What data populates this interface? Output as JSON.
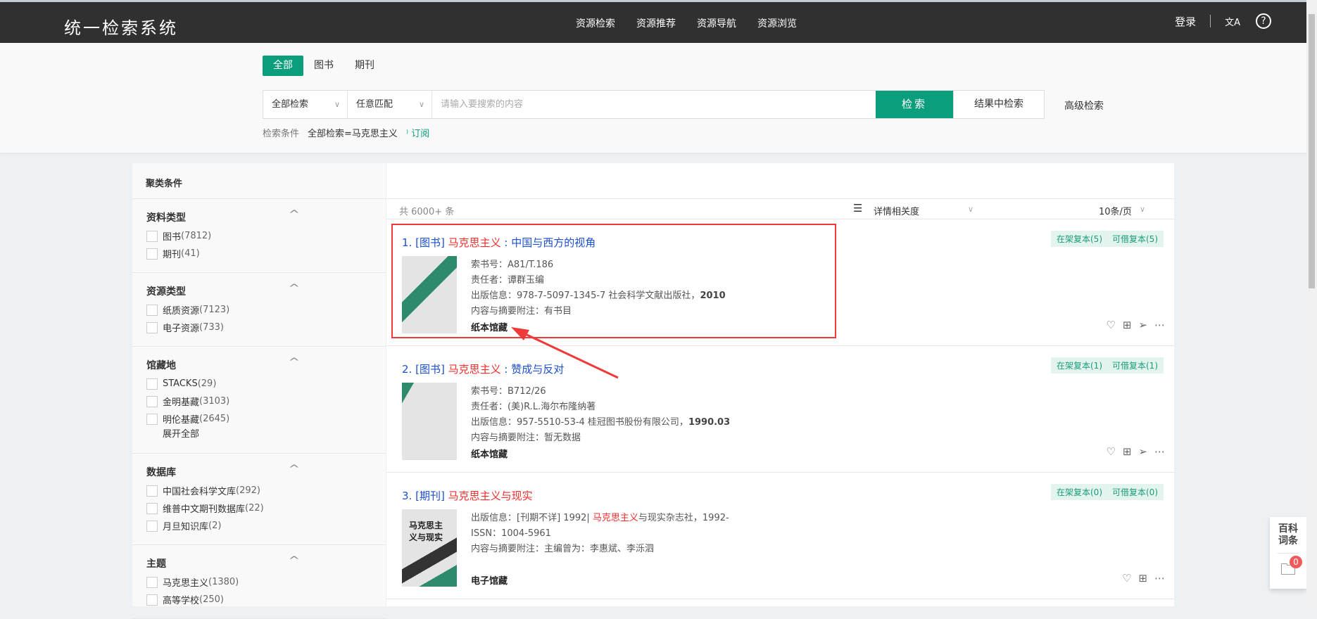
{
  "header": {
    "title": "统一检索系统",
    "nav": [
      "资源检索",
      "资源推荐",
      "资源导航",
      "资源浏览"
    ],
    "login": "登录",
    "translate_icon": "文A",
    "help_icon": "?"
  },
  "search": {
    "tabs": [
      "全部",
      "图书",
      "期刊"
    ],
    "scope": "全部检索",
    "match": "任意匹配",
    "placeholder": "请输入要搜索的内容",
    "search_btn": "检索",
    "refine_btn": "结果中检索",
    "advanced": "高级检索",
    "cond_label": "检索条件",
    "cond_value": "全部检索=马克思主义",
    "subscribe": "订阅"
  },
  "sidebar": {
    "title": "聚类条件",
    "sections": [
      {
        "title": "资料类型",
        "items": [
          {
            "label": "图书",
            "count": "(7812)"
          },
          {
            "label": "期刊",
            "count": "(41)"
          }
        ]
      },
      {
        "title": "资源类型",
        "items": [
          {
            "label": "纸质资源",
            "count": "(7123)"
          },
          {
            "label": "电子资源",
            "count": "(733)"
          }
        ]
      },
      {
        "title": "馆藏地",
        "items": [
          {
            "label": "STACKS",
            "count": "(29)"
          },
          {
            "label": "金明基藏",
            "count": "(3103)"
          },
          {
            "label": "明伦基藏",
            "count": "(2645)"
          }
        ],
        "more": "展开全部"
      },
      {
        "title": "数据库",
        "items": [
          {
            "label": "中国社会科学文库",
            "count": "(292)"
          },
          {
            "label": "维普中文期刊数据库",
            "count": "(22)"
          },
          {
            "label": "月旦知识库",
            "count": "(2)"
          }
        ]
      },
      {
        "title": "主题",
        "items": [
          {
            "label": "马克思主义",
            "count": "(1380)"
          },
          {
            "label": "高等学校",
            "count": "(250)"
          }
        ]
      }
    ]
  },
  "toolbar": {
    "count": "共 6000+ 条",
    "sort": "相关度",
    "view": "详情",
    "per_page": "10条/页"
  },
  "results": [
    {
      "num": "1.",
      "type": "[图书]",
      "hl": "马克思主义",
      "rest": " : 中国与西方的视角",
      "rest_red": false,
      "lines": [
        [
          "索书号：",
          "A81/T.186",
          ""
        ],
        [
          "责任者：",
          "谭群玉编",
          ""
        ],
        [
          "出版信息：",
          "978-7-5097-1345-7  社会科学文献出版社，",
          "2010"
        ],
        [
          "内容与摘要附注：",
          "有书目",
          ""
        ]
      ],
      "loc": "纸本馆藏",
      "tag1": "在架复本(5)",
      "tag2": "可借复本(5)"
    },
    {
      "num": "2.",
      "type": "[图书]",
      "hl": "马克思主义",
      "rest": " : 赞成与反对",
      "rest_red": false,
      "lines": [
        [
          "索书号：",
          "B712/26",
          ""
        ],
        [
          "责任者：",
          "(美)R.L.海尔布隆纳著",
          ""
        ],
        [
          "出版信息：",
          "957-5510-53-4  桂冠图书股份有限公司，",
          "1990.03"
        ],
        [
          "内容与摘要附注：",
          "暂无数据",
          ""
        ]
      ],
      "loc": "纸本馆藏",
      "tag1": "在架复本(1)",
      "tag2": "可借复本(1)"
    },
    {
      "num": "3.",
      "type": "[期刊]",
      "hl": "马克思主义",
      "rest": "与现实",
      "rest_red": true,
      "lines": [
        [
          "出版信息：",
          "[刊期不详] 1992| ",
          ""
        ],
        [
          "ISSN：",
          "1004-5961",
          ""
        ],
        [
          "内容与摘要附注：",
          "主编曾为：李惠斌、李泺泗",
          ""
        ]
      ],
      "pub_hl": "马克思主义",
      "pub_rest": "与现实杂志社，1992-",
      "cover_text": "马克思主义与现实",
      "loc": "电子馆藏",
      "tag1": "在架复本(0)",
      "tag2": "可借复本(0)"
    }
  ],
  "widget": {
    "baike": "百科词条",
    "badge": "0"
  },
  "colors": {
    "accent": "#0b9e7c",
    "highlight": "#f02d2d",
    "link": "#1b4fcf",
    "annotation": "#f03a3a"
  }
}
